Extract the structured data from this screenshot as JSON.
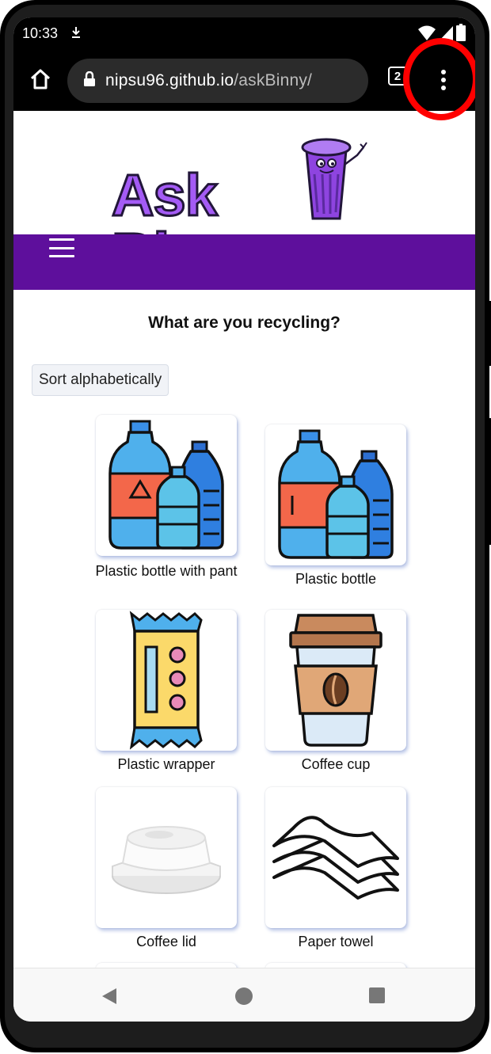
{
  "status_bar": {
    "time": "10:33",
    "icons": [
      "download-icon",
      "wifi-icon",
      "cellular-icon",
      "battery-icon"
    ]
  },
  "browser": {
    "url_host": "nipsu96.github.io",
    "url_path": "/askBinny/",
    "tab_count": "2",
    "icons": [
      "home-icon",
      "lock-icon",
      "tabs-icon",
      "more-vert-icon"
    ]
  },
  "site": {
    "logo_text": "Ask Binny",
    "brand_color": "#5e0f9c",
    "logo_color": "#a45bf5"
  },
  "page": {
    "heading": "What are you recycling?",
    "sort_button": "Sort alphabetically"
  },
  "items": [
    {
      "label": "Plastic bottle with pant",
      "icon": "plastic-bottle-recycle-icon"
    },
    {
      "label": "Plastic bottle",
      "icon": "plastic-bottle-icon"
    },
    {
      "label": "Plastic wrapper",
      "icon": "plastic-wrapper-icon"
    },
    {
      "label": "Coffee cup",
      "icon": "coffee-cup-icon"
    },
    {
      "label": "Coffee lid",
      "icon": "coffee-lid-icon"
    },
    {
      "label": "Paper towel",
      "icon": "paper-towel-icon"
    }
  ],
  "nav_bar": {
    "icons": [
      "back-icon",
      "home-circle-icon",
      "recents-icon"
    ]
  },
  "highlight_color": "#ff0000"
}
